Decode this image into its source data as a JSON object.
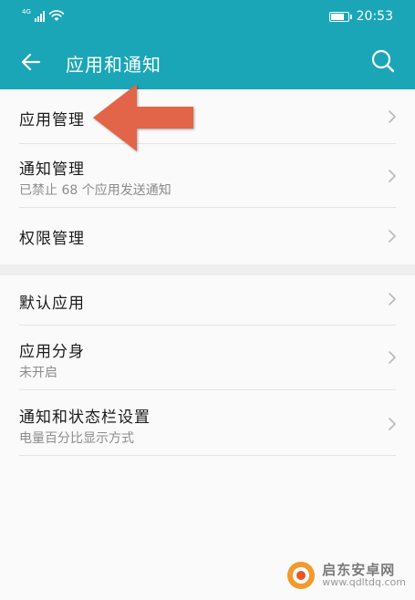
{
  "status_bar": {
    "network": "4G",
    "time": "20:53",
    "battery_level": 0.85
  },
  "app_bar": {
    "title": "应用和通知"
  },
  "groups": [
    {
      "items": [
        {
          "title": "应用管理",
          "subtitle": ""
        },
        {
          "title": "通知管理",
          "subtitle": "已禁止 68 个应用发送通知"
        },
        {
          "title": "权限管理",
          "subtitle": ""
        }
      ]
    },
    {
      "items": [
        {
          "title": "默认应用",
          "subtitle": ""
        },
        {
          "title": "应用分身",
          "subtitle": "未开启"
        },
        {
          "title": "通知和状态栏设置",
          "subtitle": "电量百分比显示方式"
        }
      ]
    }
  ],
  "annotation": {
    "arrow_color": "#e2654a",
    "points_to": "应用管理"
  },
  "watermark": {
    "name": "启东安卓网",
    "url": "www.qdltdq.com"
  },
  "colors": {
    "app_bar": "#1aa6b7",
    "background": "#fafafa",
    "title_text": "#1b1b1b",
    "subtitle_text": "#8c8c8c",
    "chevron": "#b8b8b8"
  },
  "icons": [
    "back-arrow-icon",
    "search-icon",
    "chevron-right-icon",
    "wifi-icon",
    "signal-icon",
    "battery-icon"
  ]
}
